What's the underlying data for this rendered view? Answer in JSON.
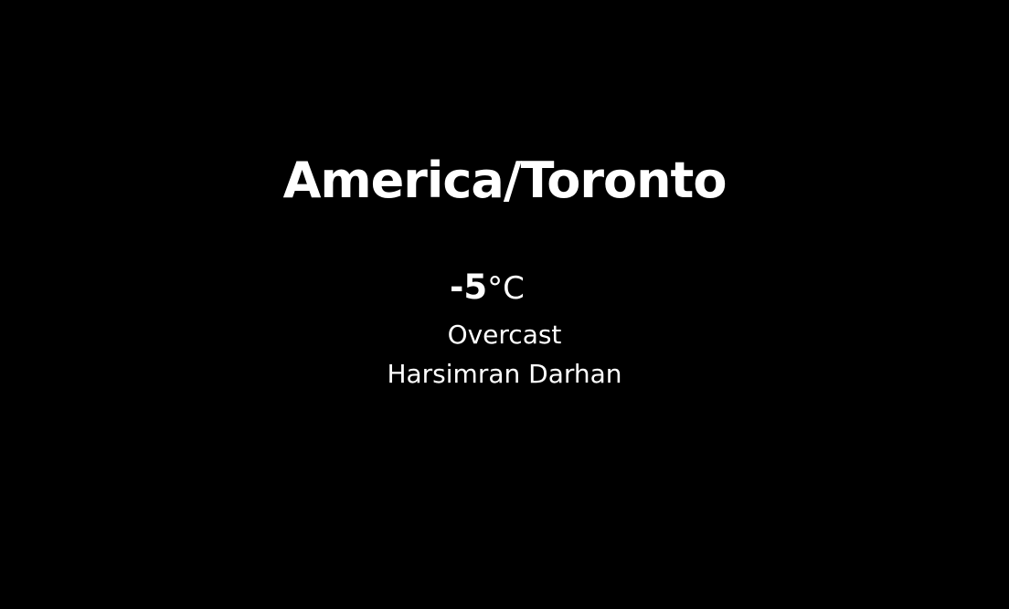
{
  "weather": {
    "location": "America/Toronto",
    "temperature": "-5",
    "unit": "°C",
    "condition": "Overcast",
    "author": "Harsimran Darhan"
  },
  "colors": {
    "background": "#000000",
    "text": "#ffffff"
  }
}
